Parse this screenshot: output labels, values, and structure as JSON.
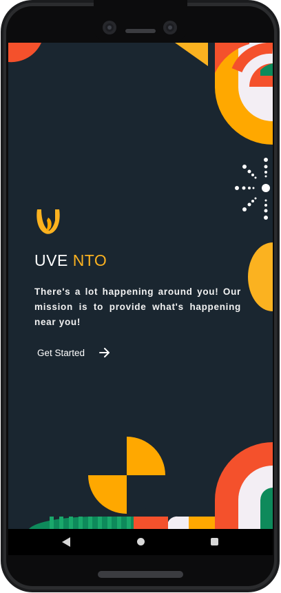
{
  "app": {
    "brand_part1": "UVE",
    "brand_part2": "NTO",
    "tagline": "There's a lot happening around you! Our mission is to provide what's happening near you!",
    "cta_label": "Get Started"
  },
  "icons": {
    "logo": "uvento-logo-icon",
    "cta_arrow": "arrow-right-icon",
    "nav_back": "back-triangle-icon",
    "nav_home": "home-circle-icon",
    "nav_recent": "recent-apps-square-icon"
  },
  "colors": {
    "background": "#1a2630",
    "accent_yellow": "#fbb220",
    "orange": "#ffa800",
    "red": "#f4512c",
    "green": "#0e8a5b",
    "cream": "#f3eef4",
    "text": "#ffffff"
  }
}
